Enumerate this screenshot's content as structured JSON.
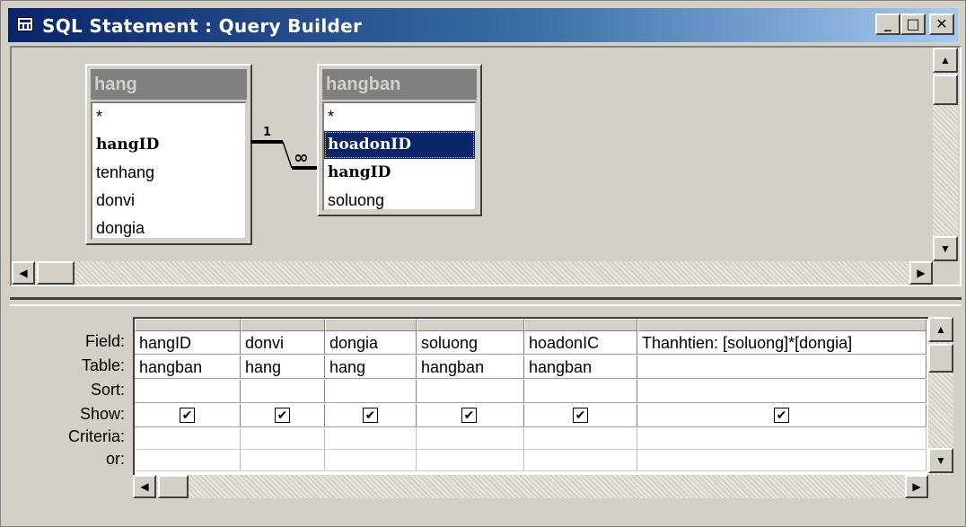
{
  "window": {
    "title": "SQL Statement : Query Builder",
    "controls": {
      "minimize": "_",
      "maximize": "□",
      "close": "✕"
    }
  },
  "tables": [
    {
      "name": "hang",
      "fields": [
        "*",
        "hangID",
        "tenhang",
        "donvi",
        "dongia"
      ],
      "key_fields": [
        "hangID"
      ]
    },
    {
      "name": "hangban",
      "fields": [
        "*",
        "hoadonID",
        "hangID",
        "soluong"
      ],
      "key_fields": [
        "hoadonID",
        "hangID"
      ],
      "selected": "hoadonID"
    }
  ],
  "relationship": {
    "one_label": "1",
    "many_label": "∞"
  },
  "grid": {
    "row_labels": {
      "field": "Field:",
      "table": "Table:",
      "sort": "Sort:",
      "show": "Show:",
      "criteria": "Criteria:",
      "or": "or:"
    },
    "columns": [
      {
        "field": "hangID",
        "table": "hangban",
        "sort": "",
        "show": true
      },
      {
        "field": "donvi",
        "table": "hang",
        "sort": "",
        "show": true
      },
      {
        "field": "dongia",
        "table": "hang",
        "sort": "",
        "show": true
      },
      {
        "field": "soluong",
        "table": "hangban",
        "sort": "",
        "show": true
      },
      {
        "field": "hoadonIC",
        "table": "hangban",
        "sort": "",
        "show": true
      },
      {
        "field": "Thanhtien: [soluong]*[dongia]",
        "table": "",
        "sort": "",
        "show": true
      }
    ],
    "check_glyph": "✔"
  },
  "scroll": {
    "up": "▲",
    "down": "▼",
    "left": "◀",
    "right": "▶"
  },
  "colors": {
    "title_start": "#0a246a",
    "title_end": "#a6caf0",
    "selection": "#0a246a",
    "face": "#d4d0c8"
  }
}
